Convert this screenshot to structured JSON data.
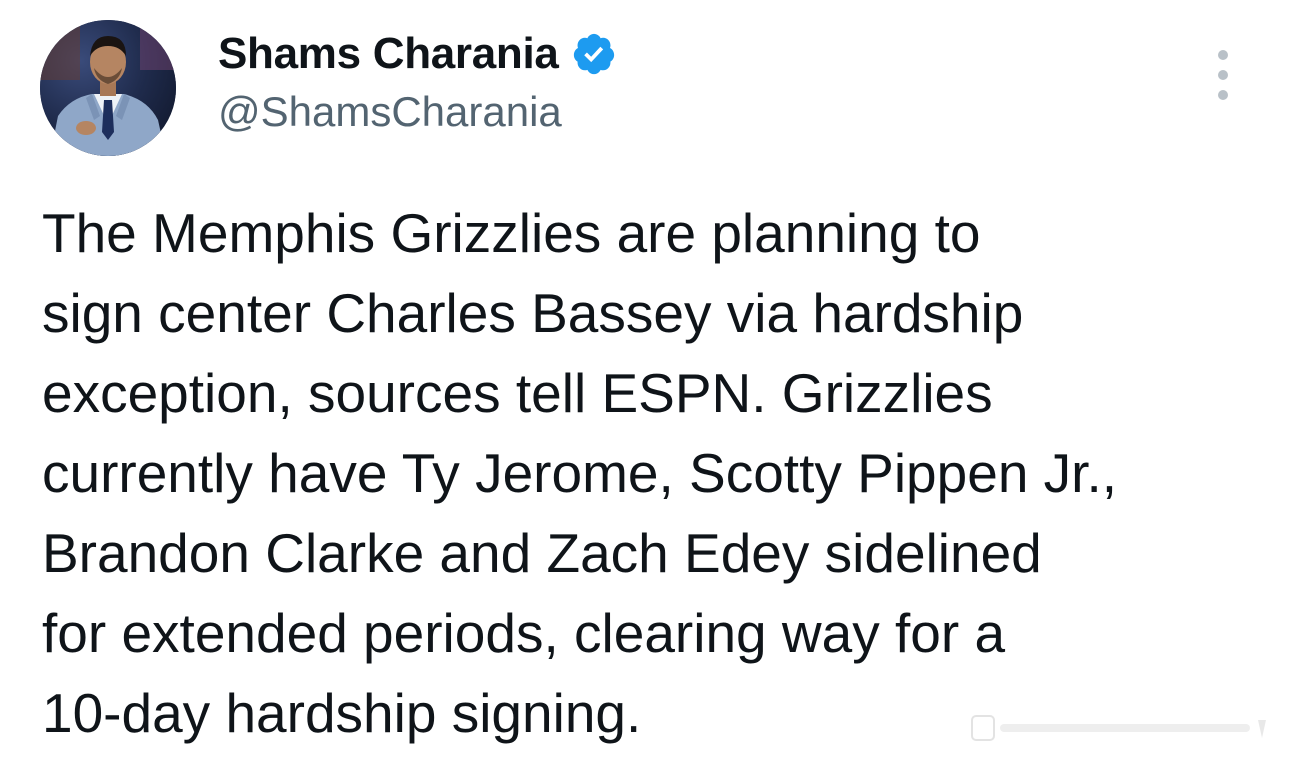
{
  "author": {
    "display_name": "Shams Charania",
    "handle": "@ShamsCharania",
    "verified": true,
    "verified_color": "#1d9bf0",
    "avatar_icon": "profile-photo"
  },
  "tweet": {
    "text": "The Memphis Grizzlies are planning to\nsign center Charles Bassey via hardship\nexception, sources tell ESPN. Grizzlies\ncurrently have Ty Jerome, Scotty Pippen Jr.,\nBrandon Clarke and Zach Edey sidelined\nfor extended periods, clearing way for a\n10-day hardship signing."
  },
  "menu": {
    "icon": "more-vertical-icon"
  },
  "colors": {
    "text_primary": "#0f1419",
    "text_secondary": "#536471"
  }
}
